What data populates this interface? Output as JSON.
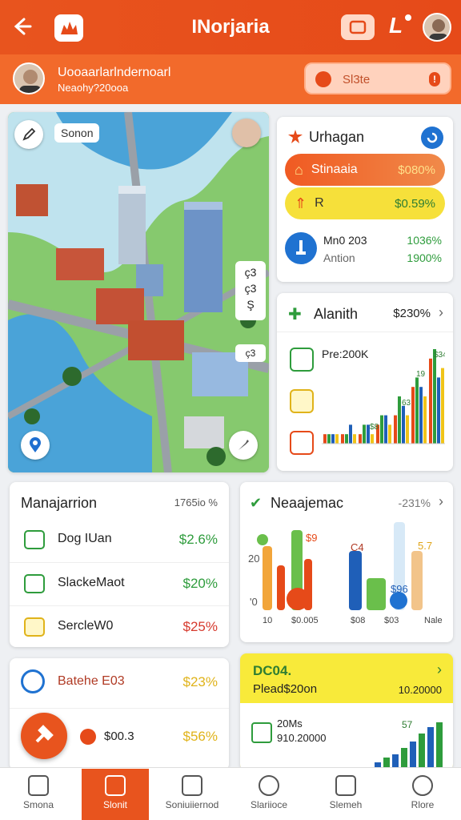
{
  "header": {
    "title": "INorjaria",
    "back_icon": "back-arrow-icon",
    "logo_icon": "flame-logo-icon",
    "bell_label": "L"
  },
  "subheader": {
    "name": "Uooaarlarlndernoarl",
    "detail": "Neaohy?20ooa",
    "search_text": "Sl3te"
  },
  "map": {
    "label": "Sonon",
    "side": [
      "ç3",
      "ç3",
      "Ş"
    ],
    "small": "ç3"
  },
  "stats_card": {
    "title": "Urhagan",
    "row1": {
      "label": "Stinaaia",
      "value": "$080%"
    },
    "row2": {
      "label": "R",
      "value": "$0.59%"
    },
    "info": {
      "line1": "Mn0 203",
      "line2": "Antion",
      "val1": "1036%",
      "val2": "1900%"
    }
  },
  "chart_card": {
    "title": "Alanith",
    "value": "$230%",
    "legend": "Pre:200K",
    "chart_data": {
      "type": "bar",
      "annotations": [
        "$34",
        "19",
        "63",
        "$8"
      ],
      "series": [
        {
          "color": "#e64a19",
          "values": [
            1,
            1,
            1,
            2,
            3,
            6,
            9
          ]
        },
        {
          "color": "#2e9c3c",
          "values": [
            1,
            1,
            2,
            3,
            5,
            7,
            10
          ]
        },
        {
          "color": "#1f5fb8",
          "values": [
            1,
            2,
            2,
            3,
            4,
            6,
            7
          ]
        },
        {
          "color": "#f0c419",
          "values": [
            1,
            1,
            1,
            2,
            3,
            5,
            8
          ]
        }
      ]
    }
  },
  "management": {
    "title": "Manajarrion",
    "badge": "1765io %",
    "items": [
      {
        "label": "Dog IUan",
        "value": "$2.6%",
        "color": "#2e9c3c",
        "icon": "bag-icon"
      },
      {
        "label": "SlackeMaot",
        "value": "$20%",
        "color": "#2e9c3c",
        "icon": "card-icon"
      },
      {
        "label": "SercleW0",
        "value": "$25%",
        "color": "#d63a2e",
        "icon": "wallet-icon"
      }
    ]
  },
  "reports": {
    "title": "Neaajemac",
    "value": "-231%",
    "labels": [
      "10",
      "$0.005",
      "$08",
      "$03",
      "Nale"
    ],
    "ann": [
      "$9",
      "C4",
      "5.7",
      "$96",
      "20",
      "'0"
    ]
  },
  "bottom_left": {
    "title": "Batehe E03",
    "value": "$23%",
    "row": {
      "label": "$00.3",
      "value": "$56%"
    }
  },
  "bottom_right": {
    "title": "DC04.",
    "subtitle": "Plead$20on",
    "value": "10.20000",
    "line1": "20Ms",
    "line2": "910.20000",
    "ann": "57"
  },
  "tabs": [
    {
      "label": "Smona",
      "icon": "home-icon"
    },
    {
      "label": "Slonit",
      "icon": "store-icon"
    },
    {
      "label": "Soniuiiernod",
      "icon": "calendar-icon"
    },
    {
      "label": "Slariioce",
      "icon": "smile-icon"
    },
    {
      "label": "Slemeh",
      "icon": "tag-icon"
    },
    {
      "label": "Rlore",
      "icon": "profile-icon"
    }
  ],
  "colors": {
    "accent": "#e64a19",
    "green": "#2e9c3c",
    "yellow": "#f0c419",
    "blue": "#1f5fb8"
  }
}
